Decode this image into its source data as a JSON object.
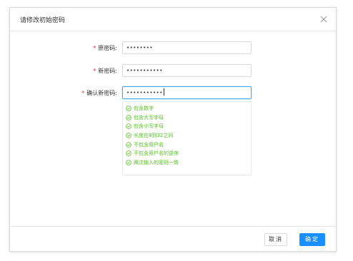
{
  "dialog": {
    "title": "请修改初始密码",
    "close_icon": "close-icon"
  },
  "form": {
    "required_mark": "*",
    "old_password": {
      "label": "原密码:",
      "value": "••••••••"
    },
    "new_password": {
      "label": "新密码:",
      "value": "•••••••••••"
    },
    "confirm_password": {
      "label": "确认新密码:",
      "value": "•••••••••••"
    }
  },
  "rules": [
    "包含数字",
    "包含大写字母",
    "包含小写字母",
    "长度在8到32之间",
    "不包含用户名",
    "不包含用户名的逆序",
    "两次输入的密码一致"
  ],
  "footer": {
    "cancel_label": "取消",
    "ok_label": "确定"
  },
  "colors": {
    "primary": "#1890ff",
    "success": "#52c41a",
    "required": "#f5222d",
    "focus_border": "#40a9ff"
  },
  "icons": {
    "rule_check": "circle-check-icon"
  }
}
